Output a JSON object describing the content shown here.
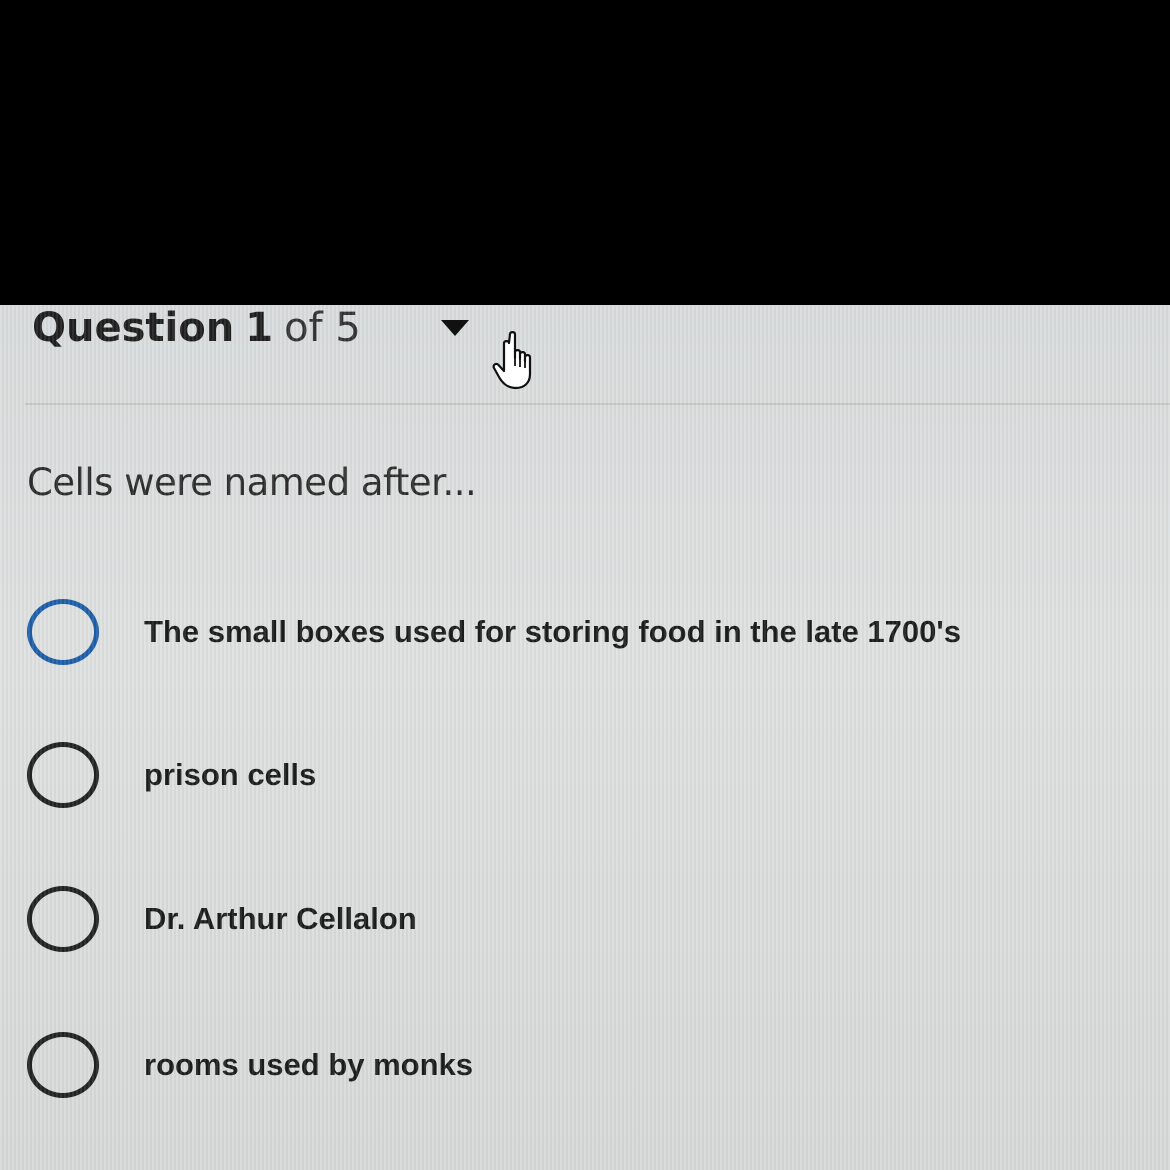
{
  "header": {
    "question_word": "Question",
    "question_number": "1",
    "of_total": "of 5",
    "dropdown_icon": "caret-down-icon"
  },
  "question": {
    "prompt": "Cells were named after..."
  },
  "options": [
    {
      "label": "The small boxes used for storing food in the late 1700's",
      "focused": true
    },
    {
      "label": "prison cells",
      "focused": false
    },
    {
      "label": "Dr. Arthur Cellalon",
      "focused": false
    },
    {
      "label": "rooms used by monks",
      "focused": false
    }
  ],
  "cursor": {
    "icon": "hand-pointer-icon"
  },
  "colors": {
    "focused_radio": "#1f5ea8",
    "radio": "#222222",
    "background": "#dcdfdf"
  }
}
